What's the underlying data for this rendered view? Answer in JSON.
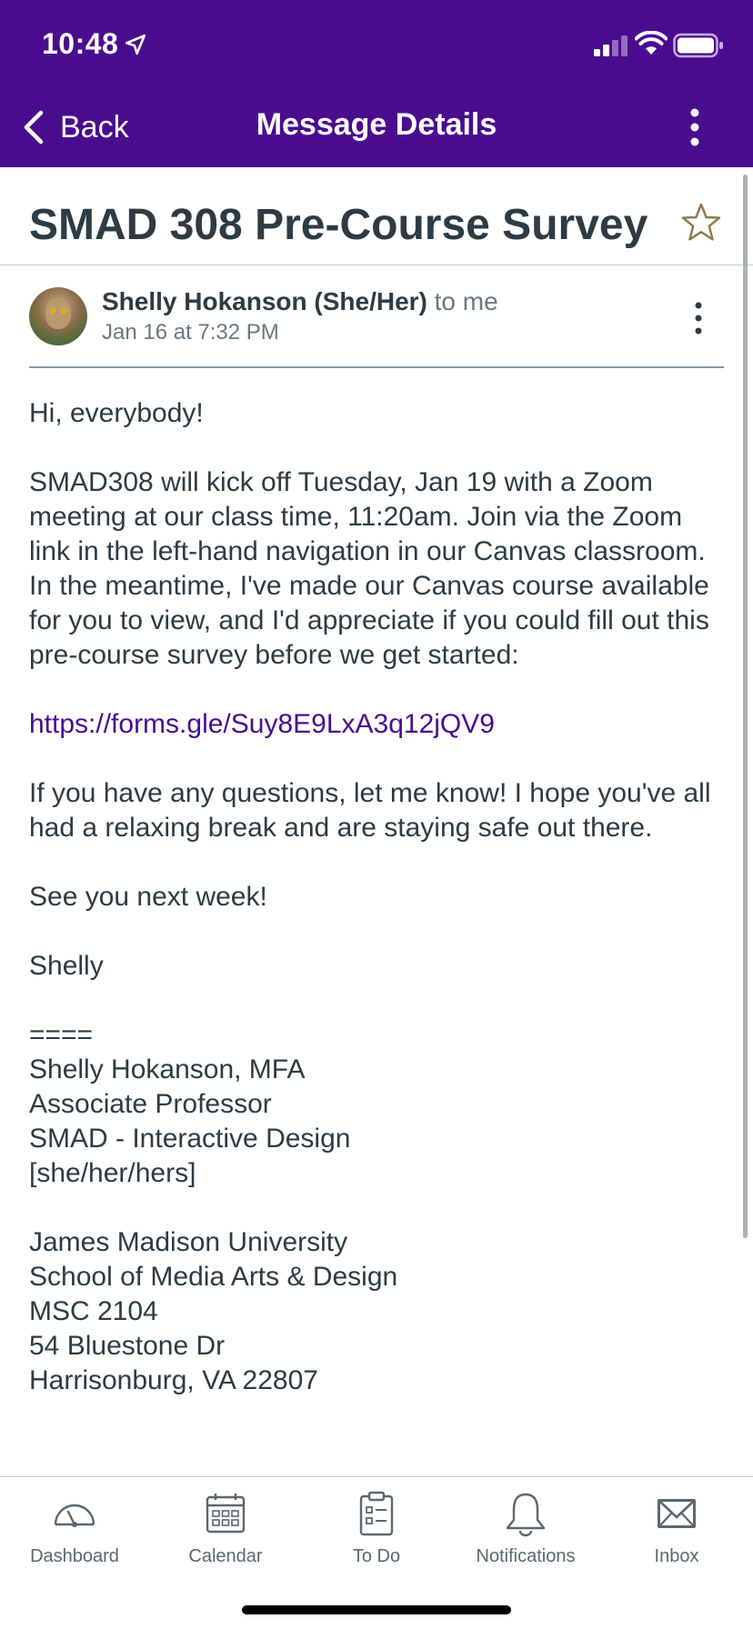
{
  "status_bar": {
    "time": "10:48"
  },
  "nav": {
    "back_label": "Back",
    "title": "Message Details"
  },
  "message": {
    "subject": "SMAD 308 Pre-Course Survey",
    "sender": "Shelly Hokanson (She/Her)",
    "recipient": "to me",
    "date": "Jan 16 at 7:32 PM",
    "body": {
      "greeting": "Hi, everybody!",
      "paragraph1": "SMAD308 will kick off Tuesday, Jan 19 with a Zoom meeting at our class time, 11:20am. Join via the Zoom link in the left-hand navigation in our Canvas classroom. In the meantime, I've made our Canvas course available for you to view, and I'd appreciate if you could fill out this pre-course survey before we get started:",
      "link": "https://forms.gle/Suy8E9LxA3q12jQV9",
      "paragraph2": "If you have any questions, let me know! I hope you've all had a relaxing break and are staying safe out there.",
      "closing": "See you next week!",
      "signoff": "Shelly",
      "signature": {
        "separator": "====",
        "line1": "Shelly Hokanson, MFA",
        "line2": "Associate Professor",
        "line3": "SMAD - Interactive Design",
        "line4": "[she/her/hers]",
        "org1": "James Madison University",
        "org2": "School of Media Arts & Design",
        "org3": "MSC 2104",
        "org4": "54 Bluestone Dr",
        "org5": "Harrisonburg, VA 22807"
      }
    }
  },
  "tabbar": {
    "items": [
      {
        "label": "Dashboard",
        "icon": "dashboard-gauge-icon"
      },
      {
        "label": "Calendar",
        "icon": "calendar-icon"
      },
      {
        "label": "To Do",
        "icon": "clipboard-icon"
      },
      {
        "label": "Notifications",
        "icon": "bell-icon"
      },
      {
        "label": "Inbox",
        "icon": "envelope-icon"
      }
    ]
  },
  "colors": {
    "header": "#4a0c8f",
    "text": "#2d3b45",
    "link": "#4a0c8f",
    "star": "#8b7a4a"
  }
}
